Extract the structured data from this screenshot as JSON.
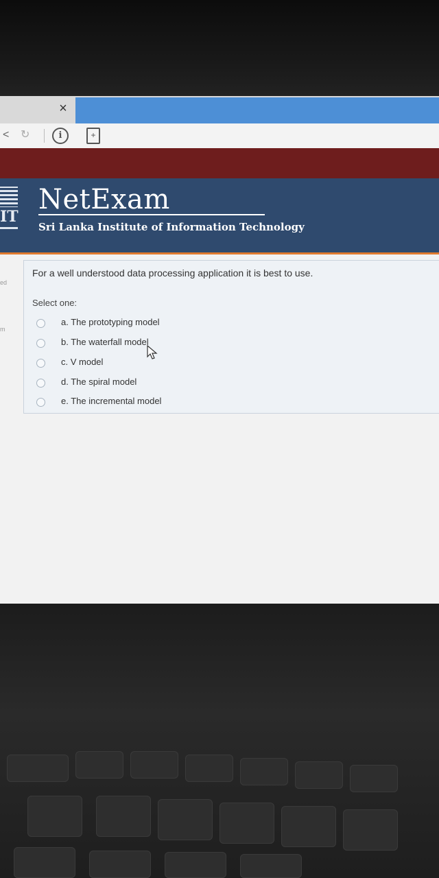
{
  "browser": {
    "tab_close_glyph": "×",
    "back_glyph": "<",
    "reload_glyph": "↻",
    "info_glyph": "i",
    "page_glyph": "+"
  },
  "header": {
    "brand": "NetExam",
    "logo_text": "IT",
    "institute": "Sri Lanka Institute of Information Technology"
  },
  "sidebar_fragments": [
    "ed",
    "m"
  ],
  "question": {
    "text": "For a well understood data processing application it is best to use.",
    "prompt": "Select one:",
    "options": [
      {
        "label": "a. The prototyping model",
        "selected": false
      },
      {
        "label": "b. The waterfall model",
        "selected": false
      },
      {
        "label": "c. V model",
        "selected": false
      },
      {
        "label": "d. The spiral model",
        "selected": false
      },
      {
        "label": "e. The incremental model",
        "selected": false
      }
    ]
  },
  "colors": {
    "maroon_bar": "#6e1d1d",
    "header_bg": "#2f4a6e",
    "accent_orange": "#e07a2e",
    "active_tab": "#4d8fd6"
  }
}
